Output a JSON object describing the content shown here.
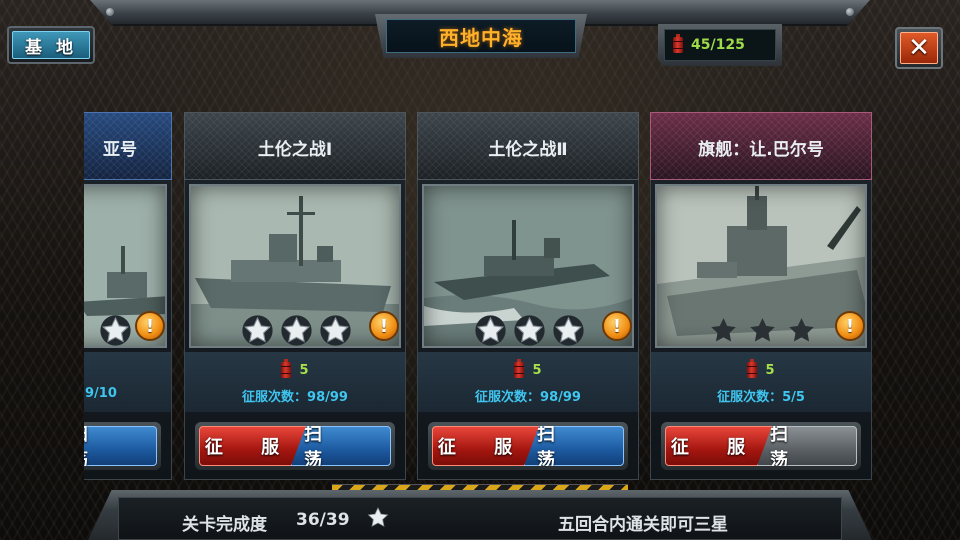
{
  "header": {
    "title": "西地中海",
    "base_button": "基 地",
    "fuel": "45/125",
    "close_label": "✕"
  },
  "colors": {
    "title": "#ffb12a",
    "conquer_count": "#3fc6f0",
    "cost": "#a6e04a",
    "conquer_button": "#c0221a",
    "sweep_button": "#2a6db8",
    "flagship_header": "#6c2e47"
  },
  "cards": [
    {
      "title": "亚号",
      "cost": "",
      "conquer": "9/10",
      "conquer_label": "",
      "stars": "2 of 3 visible (partially cropped)",
      "header_style": "blue-elite",
      "conquer_button": "",
      "sweep_button": "扫 荡"
    },
    {
      "title": "土伦之战Ⅰ",
      "cost": "5",
      "conquer_label": "征服次数：98/99",
      "stars": "3 of 3",
      "header_style": "normal",
      "conquer_button": "征 服",
      "sweep_button": "扫 荡"
    },
    {
      "title": "土伦之战Ⅱ",
      "cost": "5",
      "conquer_label": "征服次数：98/99",
      "stars": "3 of 3",
      "header_style": "normal",
      "conquer_button": "征 服",
      "sweep_button": "扫 荡"
    },
    {
      "title": "旗舰：让.巴尔号",
      "cost": "5",
      "conquer_label": "征服次数：5/5",
      "stars": "0 of 3",
      "header_style": "flagship",
      "conquer_button": "征 服",
      "sweep_button": "扫 荡",
      "sweep_disabled": true
    }
  ],
  "card_alert": "!",
  "footer": {
    "progress_label": "关卡完成度",
    "progress_value": "36/39",
    "tip": "五回合内通关即可三星"
  }
}
